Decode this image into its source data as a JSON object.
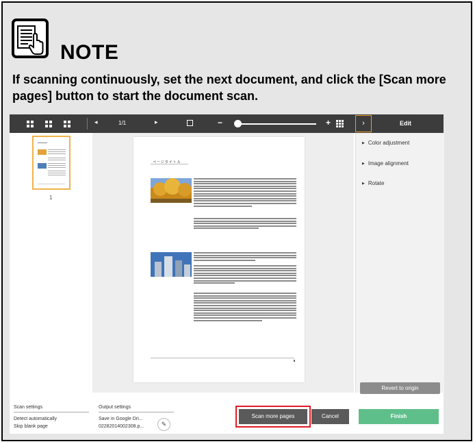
{
  "note": {
    "title": "NOTE",
    "text": "If scanning continuously, set the next document, and click the [Scan more pages] button to start the document scan.",
    "icon": "note-document-icon"
  },
  "toolbar": {
    "page_indicator": "1/1",
    "prev_arrow": "◂",
    "next_arrow": "▸",
    "zoom_out": "−",
    "zoom_in": "+",
    "panel_toggle": "›",
    "panel_title": "Edit"
  },
  "thumbnails": {
    "page_number": "1"
  },
  "document": {
    "heading": "ページタイトル"
  },
  "edit_panel": {
    "items": [
      "Color adjustment",
      "Image alignment",
      "Rotate"
    ],
    "revert_label": "Revert to origin"
  },
  "bottom_bar": {
    "scan_settings_label": "Scan settings",
    "scan_settings_values": [
      "Detect automatically",
      "Skip blank page"
    ],
    "output_settings_label": "Output settings",
    "output_settings_values": [
      "Save in Google Dri...",
      "02282014002308.p..."
    ],
    "scan_more_label": "Scan more pages",
    "cancel_label": "Cancel",
    "finish_label": "Finish"
  },
  "colors": {
    "toolbar_bg": "#3c3c3c",
    "highlight_outline": "#e01b24",
    "finish_green": "#5fbf8a",
    "thumb_border": "#f0b24a"
  }
}
